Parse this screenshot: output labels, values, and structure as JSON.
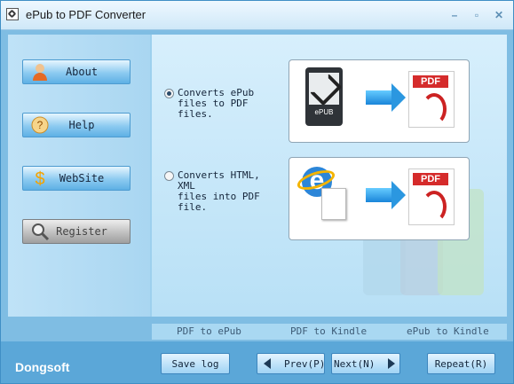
{
  "window": {
    "title": "ePub to PDF Converter",
    "minimize": "–",
    "restore": "▫",
    "close": "✕"
  },
  "sidebar": {
    "items": [
      {
        "label": "About"
      },
      {
        "label": "Help"
      },
      {
        "label": "WebSite"
      },
      {
        "label": "Register"
      }
    ]
  },
  "options": [
    {
      "label": "Converts ePub\nfiles to PDF\nfiles.",
      "checked": true,
      "reader_label": "ePUB",
      "pdf_label": "PDF"
    },
    {
      "label": "Converts HTML, XML\nfiles into PDF\nfile.",
      "checked": false,
      "ie_label": "e",
      "pdf_label": "PDF"
    }
  ],
  "tabs": [
    "PDF to ePub",
    "PDF to Kindle",
    "ePub to Kindle"
  ],
  "footer": {
    "brand": "Dongsoft",
    "save_log": "Save log",
    "prev": "Prev(P)",
    "next": "Next(N)",
    "repeat": "Repeat(R)"
  },
  "colors": {
    "accent": "#4d9bd0",
    "pdf": "#d52b2b"
  }
}
